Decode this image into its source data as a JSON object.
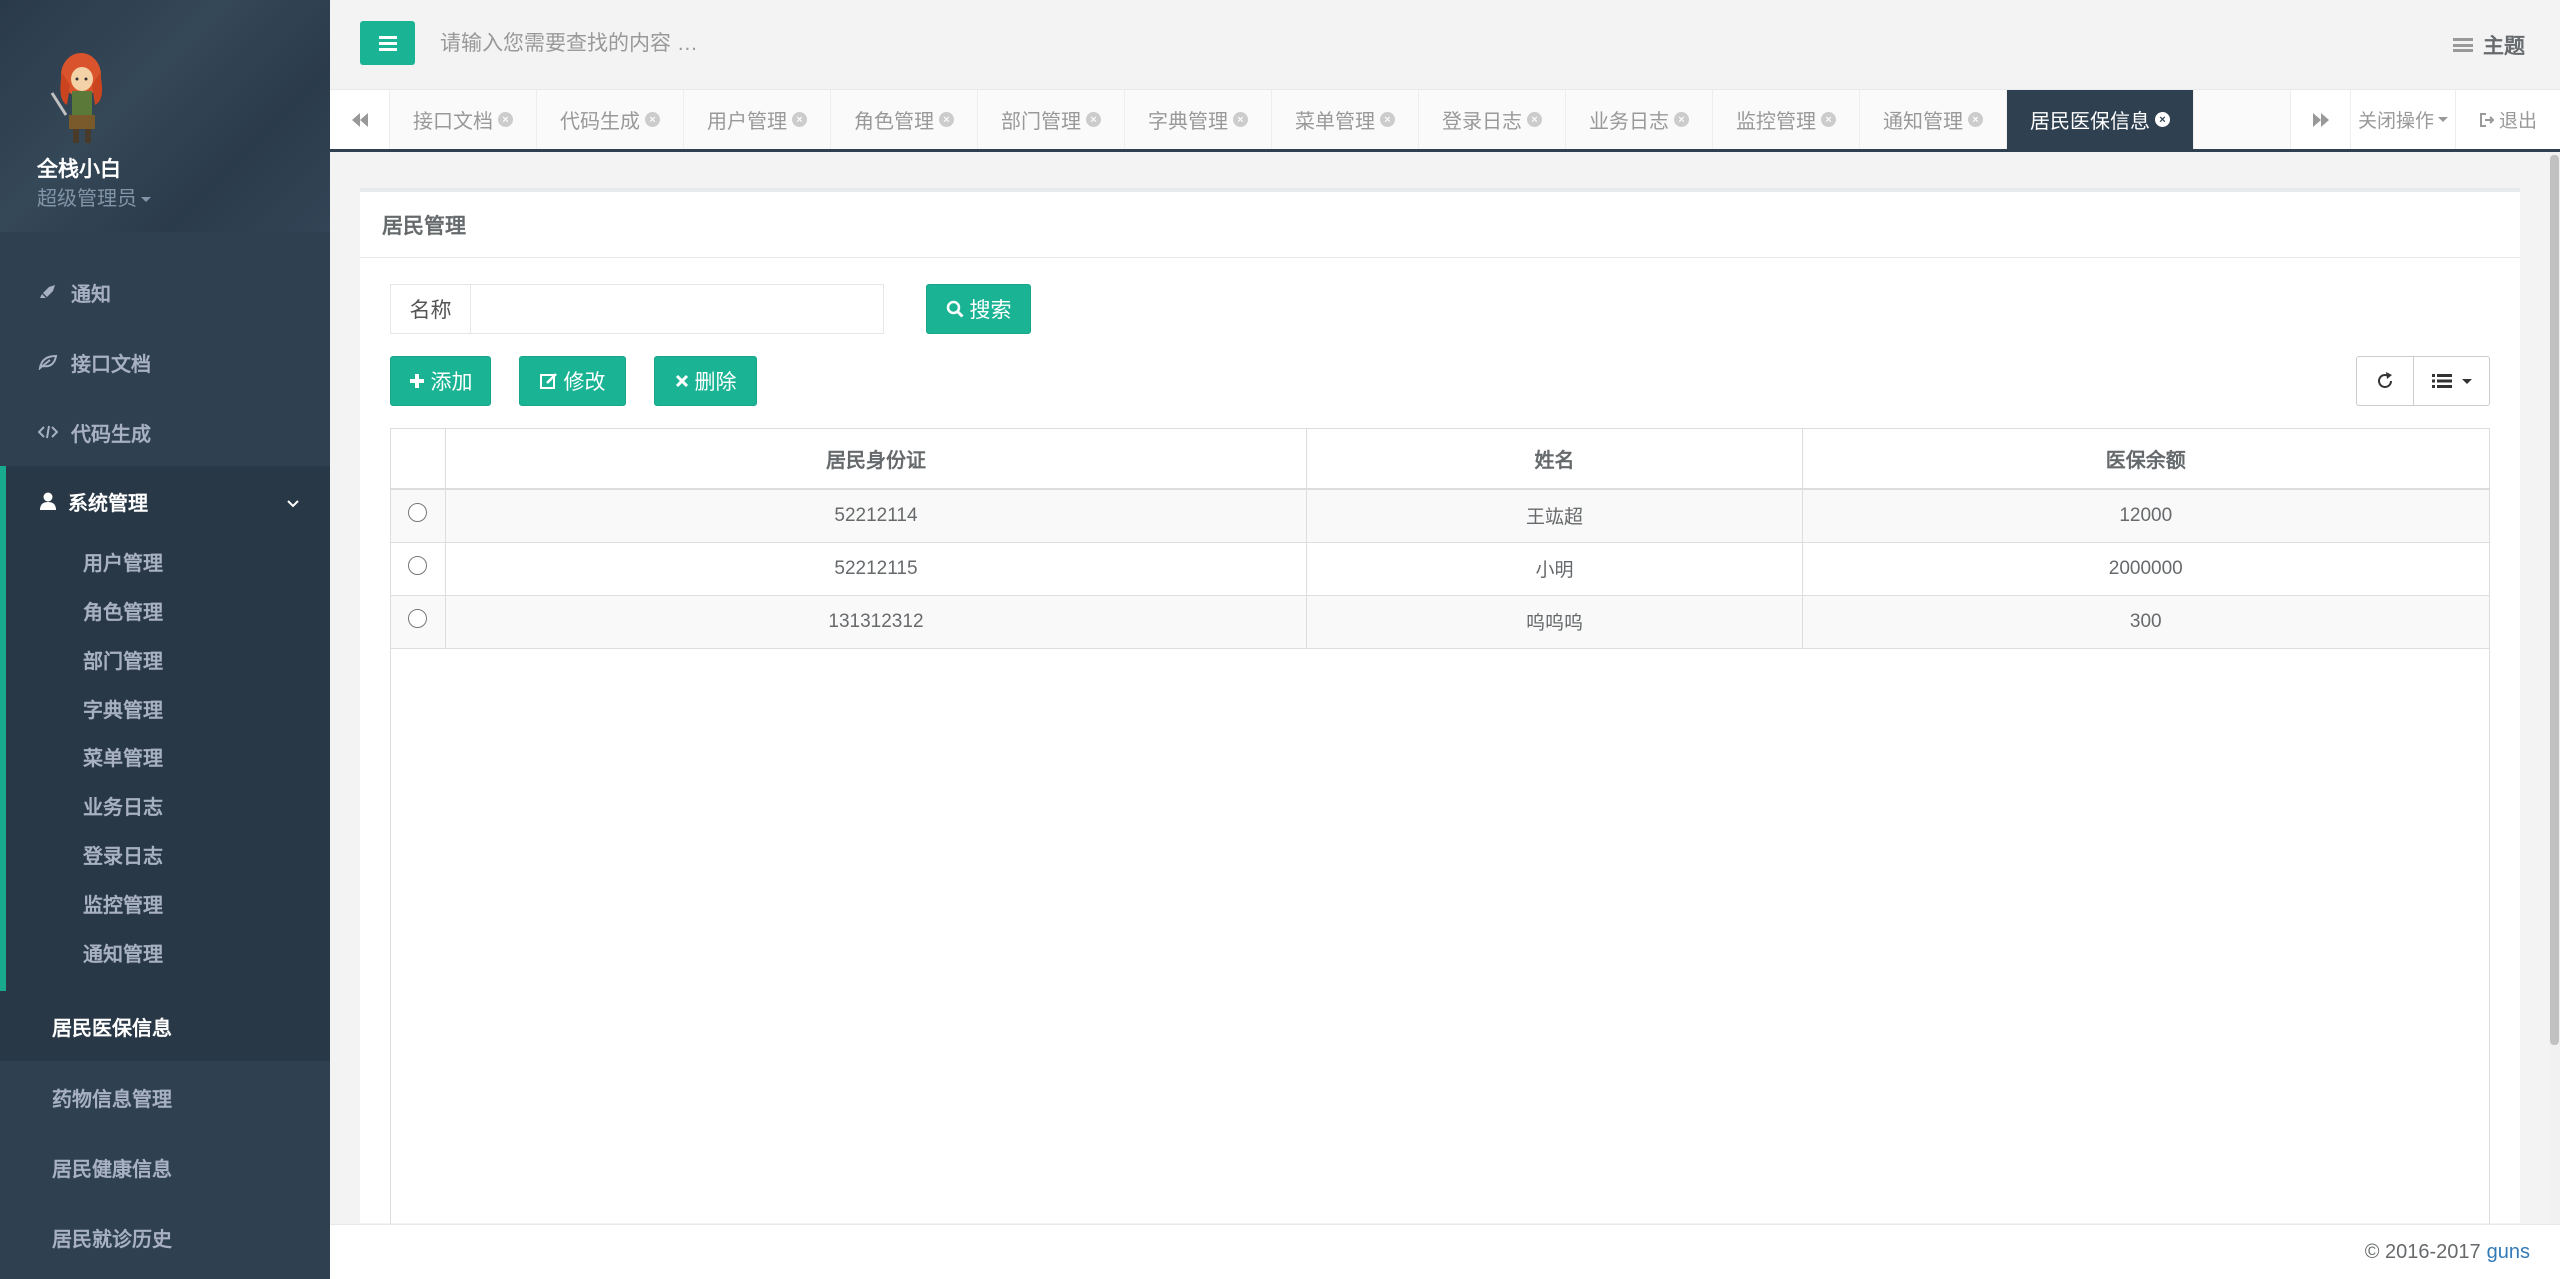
{
  "profile": {
    "name": "全栈小白",
    "role": "超级管理员"
  },
  "sidebar": {
    "items": [
      {
        "label": "通知",
        "icon": "rocket-icon"
      },
      {
        "label": "接口文档",
        "icon": "leaf-icon"
      },
      {
        "label": "代码生成",
        "icon": "code-icon"
      }
    ],
    "active_group": {
      "label": "系统管理",
      "icon": "user-icon",
      "children": [
        "用户管理",
        "角色管理",
        "部门管理",
        "字典管理",
        "菜单管理",
        "业务日志",
        "登录日志",
        "监控管理",
        "通知管理"
      ]
    },
    "highlighted": "居民医保信息",
    "lower_items": [
      "药物信息管理",
      "居民健康信息",
      "居民就诊历史"
    ]
  },
  "header": {
    "search_placeholder": "请输入您需要查找的内容 …",
    "theme_label": "主题"
  },
  "tabs": {
    "items": [
      "接口文档",
      "代码生成",
      "用户管理",
      "角色管理",
      "部门管理",
      "字典管理",
      "菜单管理",
      "登录日志",
      "业务日志",
      "监控管理",
      "通知管理"
    ],
    "active": "居民医保信息",
    "close_ops_label": "关闭操作",
    "logout_label": "退出"
  },
  "panel": {
    "title": "居民管理",
    "search_field_label": "名称",
    "search_field_value": "",
    "search_button": "搜索",
    "add_button": "添加",
    "edit_button": "修改",
    "delete_button": "删除"
  },
  "table": {
    "columns": [
      "居民身份证",
      "姓名",
      "医保余额"
    ],
    "rows": [
      [
        "52212114",
        "王竑超",
        "12000"
      ],
      [
        "52212115",
        "小明",
        "2000000"
      ],
      [
        "131312312",
        "呜呜呜",
        "300"
      ]
    ]
  },
  "footer": {
    "copyright": "© 2016-2017",
    "link": "guns"
  },
  "colors": {
    "accent": "#1ab394",
    "sidebar": "#2f4050"
  }
}
